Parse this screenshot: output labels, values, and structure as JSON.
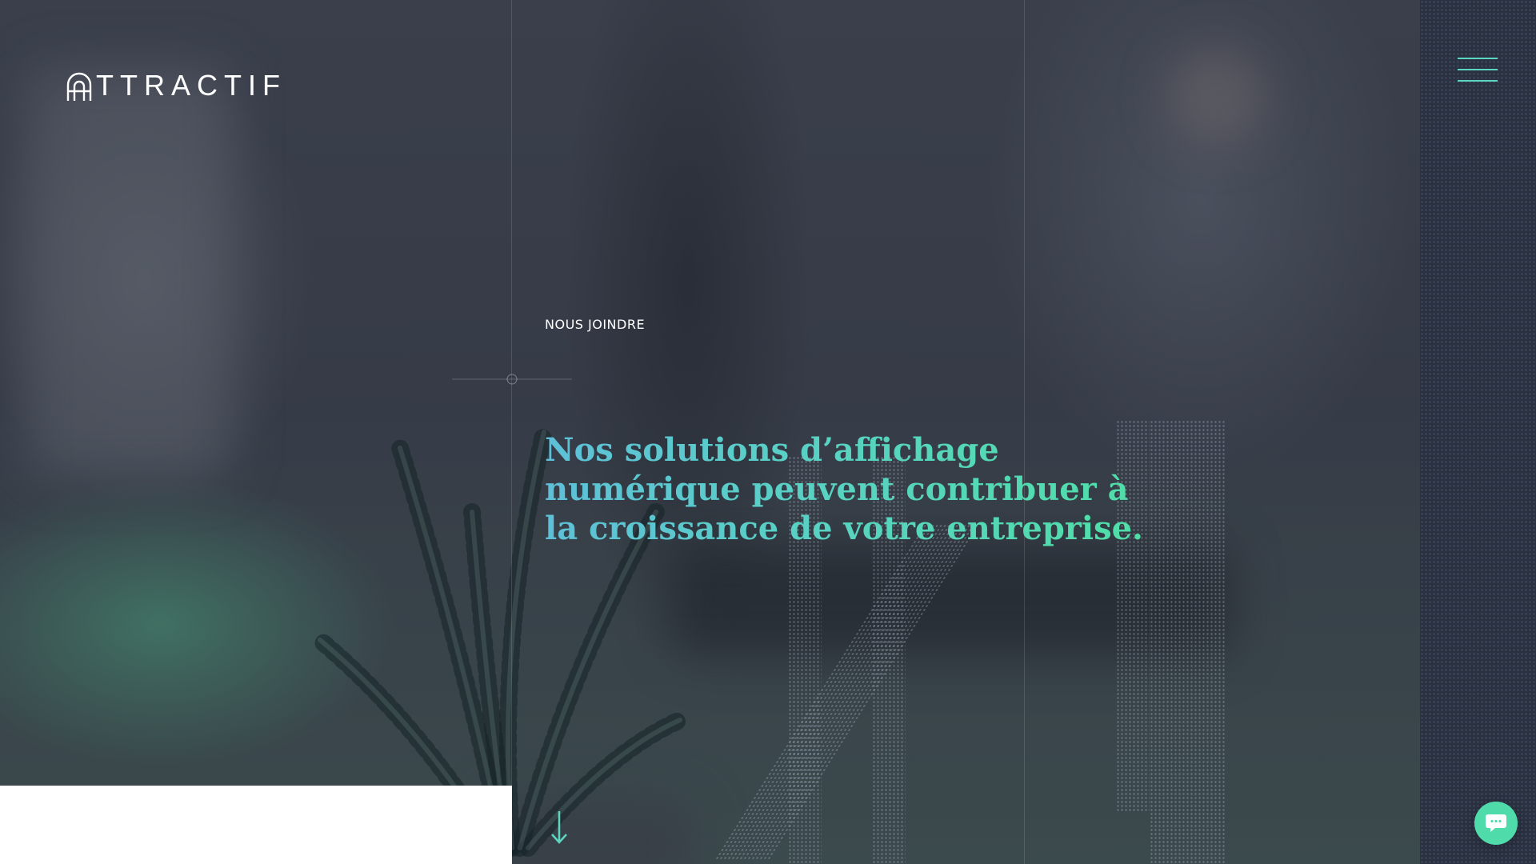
{
  "brand": {
    "name": "TTRACTIF",
    "logo_alt": "Attractif"
  },
  "hero": {
    "eyebrow": "NOUS JOINDRE",
    "headline": "Nos solutions d’affichage numérique peuvent contribuer à la croissance de votre entreprise."
  },
  "icons": {
    "menu": "hamburger-menu-icon",
    "scroll": "arrow-down-icon",
    "chat": "chat-bubble-icon"
  },
  "colors": {
    "accent_teal": "#5cd6c1",
    "accent_green": "#4fdcaa",
    "headline_start": "#5ec0d8",
    "headline_end": "#4fdfa5",
    "background": "#363b47",
    "sidebar": "#2a3141"
  }
}
